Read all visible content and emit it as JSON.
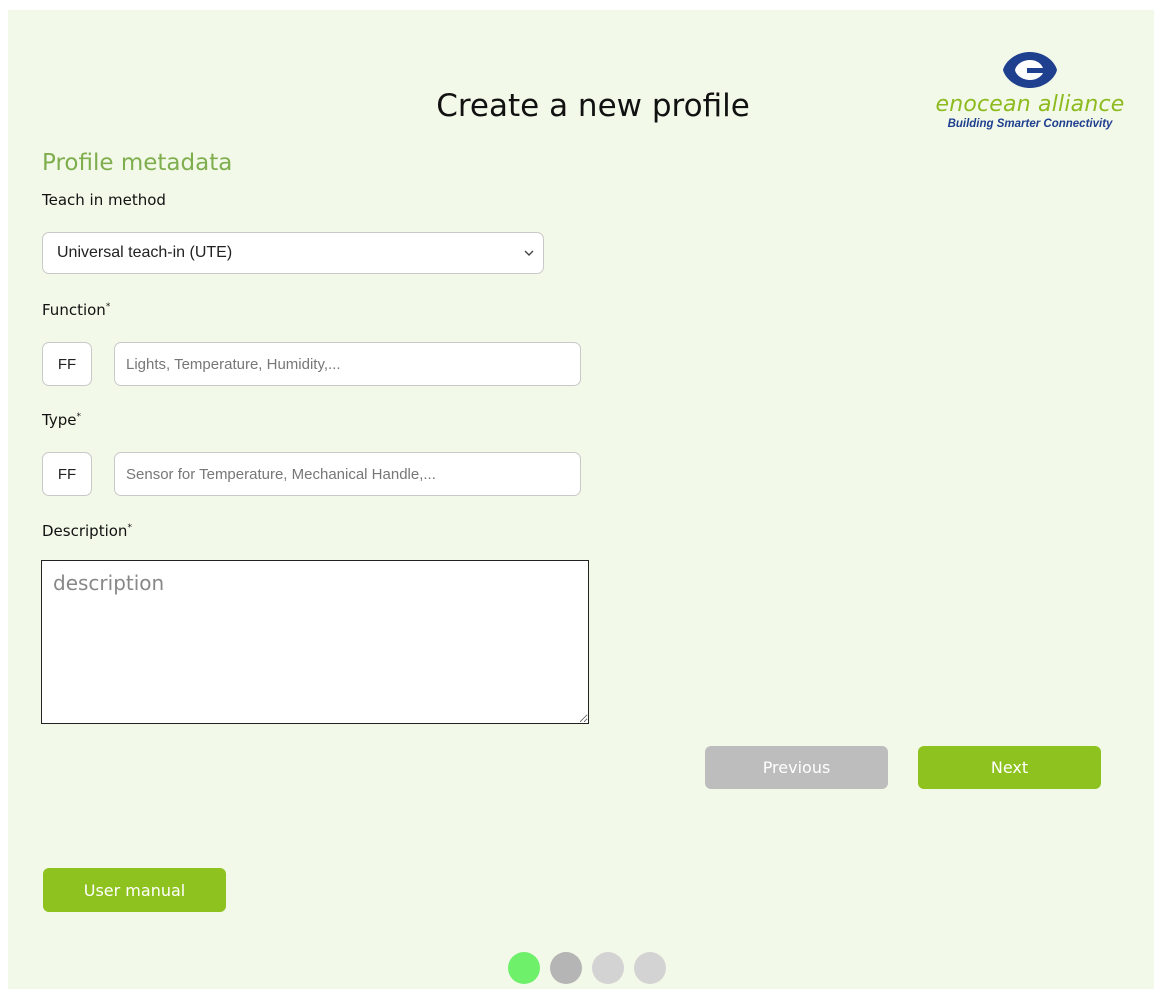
{
  "page": {
    "title": "Create a new profile"
  },
  "logo": {
    "name": "enocean alliance",
    "tagline": "Building Smarter Connectivity",
    "icon": "eye-logo-icon",
    "colors": {
      "brand_blue": "#1f3f8f",
      "brand_green": "#8dbb1f"
    }
  },
  "form": {
    "section_title": "Profile metadata",
    "teach_in": {
      "label": "Teach in method",
      "selected": "Universal teach-in (UTE)"
    },
    "function": {
      "label": "Function",
      "required_mark": "*",
      "code": "FF",
      "placeholder": "Lights, Temperature, Humidity,..."
    },
    "type": {
      "label": "Type",
      "required_mark": "*",
      "code": "FF",
      "placeholder": "Sensor for Temperature, Mechanical Handle,..."
    },
    "description": {
      "label": "Description",
      "required_mark": "*",
      "placeholder": "description"
    }
  },
  "nav": {
    "previous_label": "Previous",
    "next_label": "Next",
    "manual_label": "User manual"
  },
  "steps": {
    "count": 4,
    "current": 1,
    "colors": {
      "active": "#6ef06a",
      "visited": "#b5b5b5",
      "pending": "#d3d3d3"
    }
  },
  "colors": {
    "background": "#f3f9e9",
    "accent_green": "#8ec21f",
    "section_green": "#7fae4e",
    "disabled_gray": "#bdbdbd"
  }
}
